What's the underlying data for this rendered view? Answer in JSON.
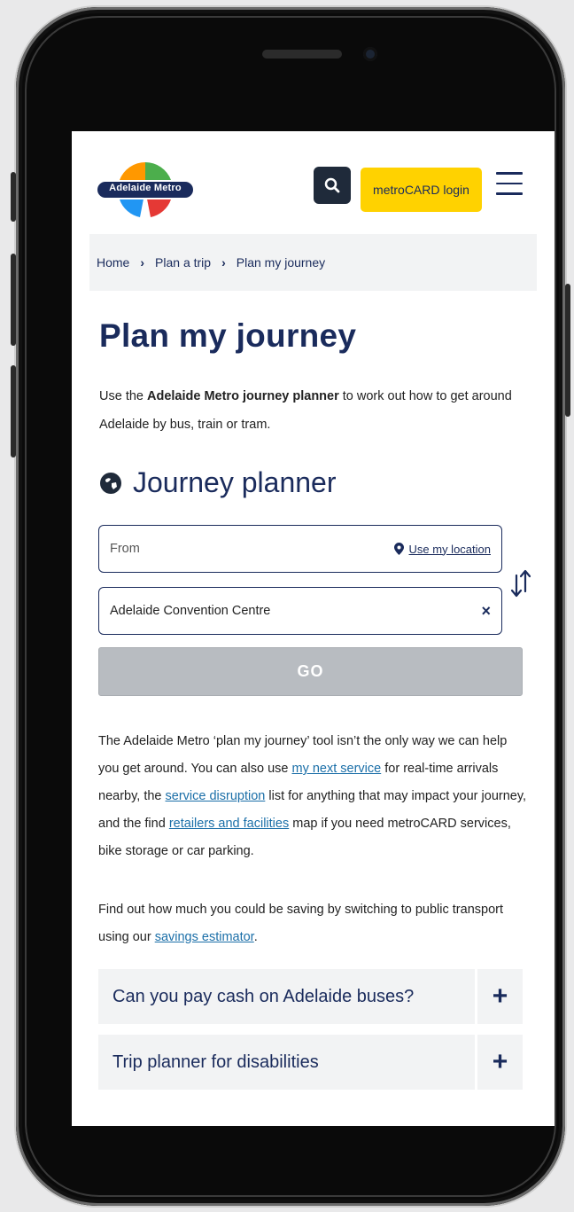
{
  "header": {
    "logo_text": "Adelaide Metro",
    "login_label": "metroCARD login",
    "colors": {
      "navy": "#1a2b5c",
      "yellow": "#ffd200",
      "green": "#4cae4c",
      "red": "#e53935",
      "blue": "#2196f3",
      "orange": "#ff9800"
    }
  },
  "breadcrumb": {
    "items": [
      {
        "label": "Home"
      },
      {
        "label": "Plan a trip"
      },
      {
        "label": "Plan my journey"
      }
    ]
  },
  "page": {
    "title": "Plan my journey",
    "intro_prefix": "Use the ",
    "intro_bold": "Adelaide Metro journey planner",
    "intro_suffix": " to work out how to get around Adelaide by bus, train or tram."
  },
  "planner": {
    "title": "Journey planner",
    "from_placeholder": "From",
    "use_location": "Use my location",
    "to_value": "Adelaide Convention Centre",
    "clear_symbol": "×",
    "go_label": "GO"
  },
  "info": {
    "p1_a": "The Adelaide Metro ‘plan my journey’ tool isn’t the only way we can help you get around. You can also use ",
    "link_next_service": "my next service",
    "p1_b": " for real-time arrivals nearby, the ",
    "link_disruption": "service disruption",
    "p1_c": " list for anything that may impact your journey, and the find ",
    "link_retailers": "retailers and facilities",
    "p1_d": " map if you need metroCARD services, bike storage or car parking.",
    "p2_a": "Find out how much you could be saving by switching to public transport using our ",
    "link_savings": "savings estimator",
    "p2_b": "."
  },
  "faq": [
    {
      "question": "Can you pay cash on Adelaide buses?",
      "toggle": "+"
    },
    {
      "question": "Trip planner for disabilities",
      "toggle": "+"
    }
  ]
}
